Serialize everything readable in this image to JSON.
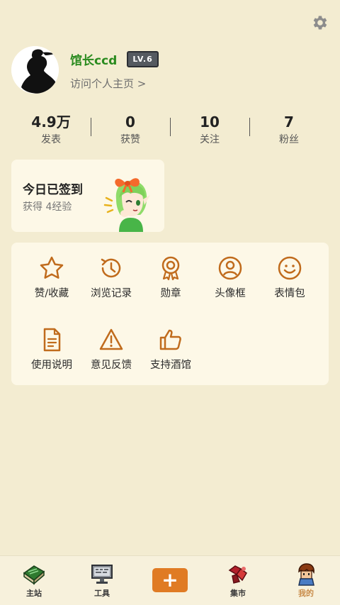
{
  "profile": {
    "username": "馆长ccd",
    "level": "LV.6",
    "visit_link": "访问个人主页 >"
  },
  "stats": [
    {
      "value": "4.9万",
      "label": "发表"
    },
    {
      "value": "0",
      "label": "获赞"
    },
    {
      "value": "10",
      "label": "关注"
    },
    {
      "value": "7",
      "label": "粉丝"
    }
  ],
  "checkin": {
    "title": "今日已签到",
    "subtitle": "获得 4经验"
  },
  "menu": {
    "favorites": "赞/收藏",
    "history": "浏览记录",
    "medals": "勋章",
    "avatar_frame": "头像框",
    "stickers": "表情包",
    "guide": "使用说明",
    "feedback": "意见反馈",
    "support": "支持酒馆"
  },
  "nav": {
    "home": "主站",
    "tools": "工具",
    "post": "+",
    "market": "集市",
    "mine": "我的"
  },
  "colors": {
    "background": "#f3ecd1",
    "card": "#fdf8e7",
    "accent": "#c06b1c",
    "username": "#2a8b1f",
    "post_button": "#e07b24"
  }
}
